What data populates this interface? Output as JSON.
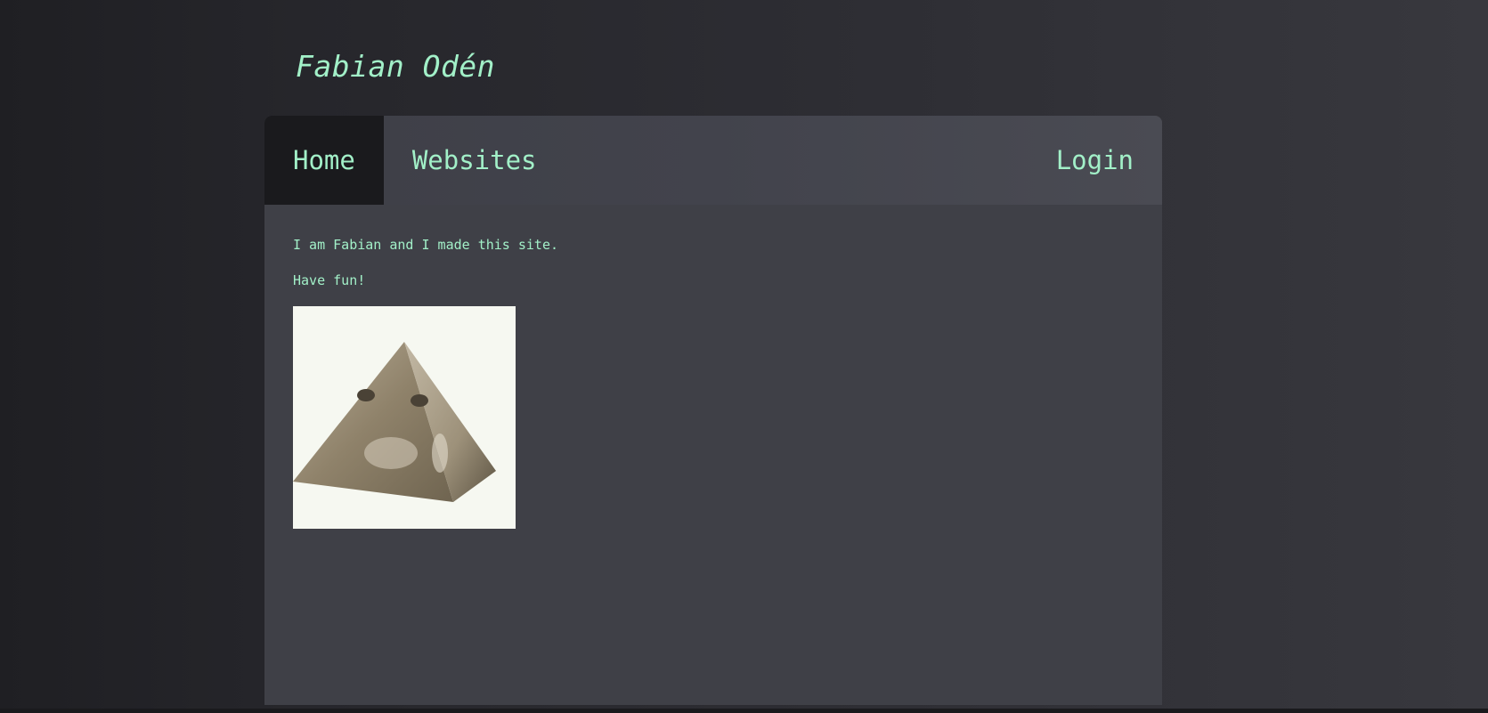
{
  "header": {
    "title": "Fabian Odén"
  },
  "nav": {
    "items": [
      {
        "label": "Home",
        "active": true
      },
      {
        "label": "Websites",
        "active": false
      }
    ],
    "login_label": "Login"
  },
  "main": {
    "paragraphs": [
      "I am Fabian and I made this site.",
      "Have fun!"
    ],
    "image": {
      "subject": "pyramid-with-rabbit-texture"
    }
  },
  "colors": {
    "accent_text": "#a2f0c8",
    "panel_bg": "#3f4047",
    "active_nav_bg": "#1a1a1d",
    "image_bg": "#f6f8f1"
  }
}
